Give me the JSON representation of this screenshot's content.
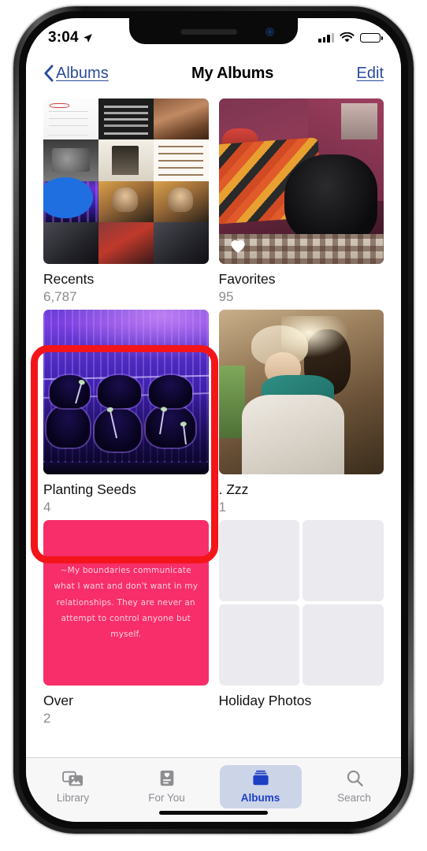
{
  "status_bar": {
    "time": "3:04",
    "location_icon": "location-arrow-icon",
    "cellular_icon": "cellular-bars-icon",
    "wifi_icon": "wifi-icon",
    "battery_icon": "battery-full-icon"
  },
  "nav": {
    "back_label": "Albums",
    "back_icon": "chevron-left-icon",
    "title": "My Albums",
    "edit_label": "Edit"
  },
  "albums": [
    {
      "title": "Recents",
      "count": "6,787",
      "thumb_kind": "collage",
      "badge": null
    },
    {
      "title": "Favorites",
      "count": "95",
      "thumb_kind": "dog-on-couch-photo",
      "badge": "heart-icon"
    },
    {
      "title": "Planting Seeds",
      "count": "4",
      "thumb_kind": "grow-light-seedlings-photo",
      "badge": null,
      "highlighted": true
    },
    {
      "title": ". Zzz",
      "count": "1",
      "thumb_kind": "hug-photo",
      "badge": null
    },
    {
      "title": "Over",
      "count": "2",
      "thumb_kind": "pink-quote-card",
      "badge": null,
      "quote": "~My boundaries communicate what I want and don't want in my relationships. They are never an attempt to control anyone but myself."
    },
    {
      "title": "Holiday Photos",
      "count": "",
      "thumb_kind": "empty-placeholder-grid",
      "badge": null
    }
  ],
  "annotation": {
    "kind": "red-highlight-rectangle",
    "target": "Planting Seeds",
    "color": "#f4151a"
  },
  "tabs": [
    {
      "label": "Library",
      "icon": "photos-library-icon",
      "active": false
    },
    {
      "label": "For You",
      "icon": "for-you-heart-card-icon",
      "active": false
    },
    {
      "label": "Albums",
      "icon": "albums-folder-icon",
      "active": true
    },
    {
      "label": "Search",
      "icon": "search-magnifier-icon",
      "active": false
    }
  ],
  "theme": {
    "accent_blue": "#1d3fc4",
    "link_blue": "#2b4b9b",
    "active_tab_bg": "#ccd4e8",
    "annotation_red": "#f4151a",
    "pink_card": "#f72e6a",
    "tab_bar_bg": "#f7f7f8"
  }
}
